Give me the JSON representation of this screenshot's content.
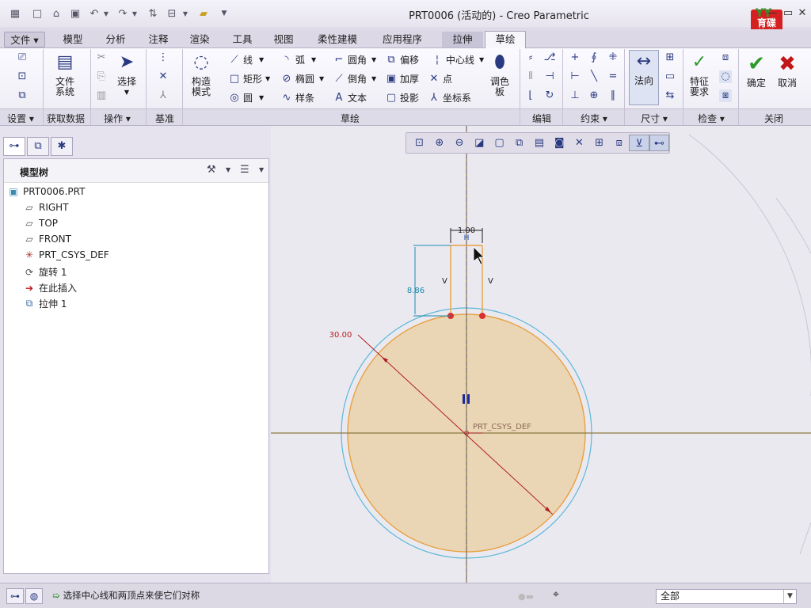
{
  "window": {
    "title": "PRT0006 (活动的) - Creo Parametric"
  },
  "brand": {
    "text": "育碟\n软件",
    "mark": "YY"
  },
  "menu_tabs": [
    "文件",
    "模型",
    "分析",
    "注释",
    "渲染",
    "工具",
    "视图",
    "柔性建模",
    "应用程序",
    "拉伸",
    "草绘"
  ],
  "ribbon": {
    "setup": {
      "file_system": "文件\n系统"
    },
    "ops": {
      "select": "选择"
    },
    "datum": {
      "construct": "构造\n模式"
    },
    "sketch": {
      "line": "线",
      "arc": "弧",
      "fillet": "圆角",
      "offset": "偏移",
      "centerline": "中心线",
      "rect": "矩形",
      "ellipse": "椭圆",
      "chamfer": "倒角",
      "thicken": "加厚",
      "point": "点",
      "circle": "圆",
      "spline": "样条",
      "text": "文本",
      "project": "投影",
      "csys": "坐标系",
      "palette": "调色\n板"
    },
    "dimension": {
      "normal": "法向"
    },
    "inspect": {
      "feature_req": "特征\n要求"
    },
    "close": {
      "ok": "确定",
      "cancel": "取消"
    },
    "groups": [
      "设置",
      "获取数据",
      "操作",
      "基准",
      "草绘",
      "编辑",
      "约束",
      "尺寸",
      "检查",
      "关闭"
    ]
  },
  "model_tree": {
    "header": "模型树",
    "items": [
      "PRT0006.PRT",
      "RIGHT",
      "TOP",
      "FRONT",
      "PRT_CSYS_DEF",
      "旋转 1",
      "在此插入",
      "拉伸 1"
    ]
  },
  "sketch": {
    "dim_width": "1.00",
    "dim_height": "8.86",
    "dim_diameter": "30.00",
    "csys_label": "PRT_CSYS_DEF",
    "constraint_v": "V"
  },
  "status": {
    "message": "选择中心线和两顶点来使它们对称",
    "filter": "全部"
  },
  "colors": {
    "sketch_fill": "#ead6b4",
    "sketch_stroke": "#e8a040",
    "ref_circle": "#5bb8d8",
    "dim": "#1c8ab0",
    "dim_red": "#c02020"
  }
}
